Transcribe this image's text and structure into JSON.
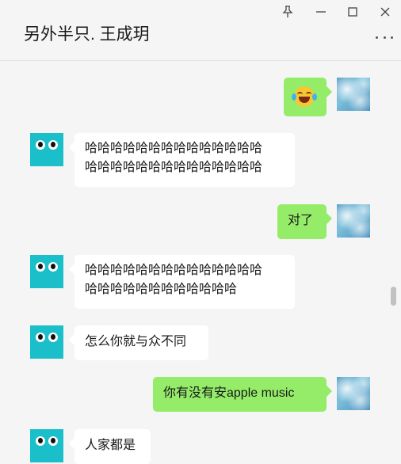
{
  "header": {
    "title": "另外半只. 王成玥",
    "pin_icon": "pin-icon",
    "minimize_icon": "minimize-icon",
    "maximize_icon": "maximize-icon",
    "close_icon": "close-icon",
    "more_icon": "more-icon"
  },
  "messages": [
    {
      "side": "out",
      "emoji": "laughing-with-tears",
      "avatar": "sky-photo-avatar"
    },
    {
      "side": "in",
      "lines": [
        "哈哈哈哈哈哈哈哈哈哈哈哈哈哈",
        "哈哈哈哈哈哈哈哈哈哈哈哈哈哈"
      ],
      "avatar": "cyan-eyes-avatar"
    },
    {
      "side": "out",
      "text": "对了",
      "avatar": "sky-photo-avatar"
    },
    {
      "side": "in",
      "lines": [
        "哈哈哈哈哈哈哈哈哈哈哈哈哈哈",
        "哈哈哈哈哈哈哈哈哈哈哈哈"
      ],
      "avatar": "cyan-eyes-avatar"
    },
    {
      "side": "in",
      "text": "怎么你就与众不同",
      "avatar": "cyan-eyes-avatar"
    },
    {
      "side": "out",
      "text": "你有没有安apple music",
      "avatar": "sky-photo-avatar"
    },
    {
      "side": "in",
      "text": "人家都是",
      "avatar": "cyan-eyes-avatar"
    }
  ],
  "colors": {
    "outgoing_bubble": "#95ec69",
    "incoming_bubble": "#ffffff",
    "background": "#f5f5f5",
    "avatar_cyan": "#1bbfca"
  }
}
